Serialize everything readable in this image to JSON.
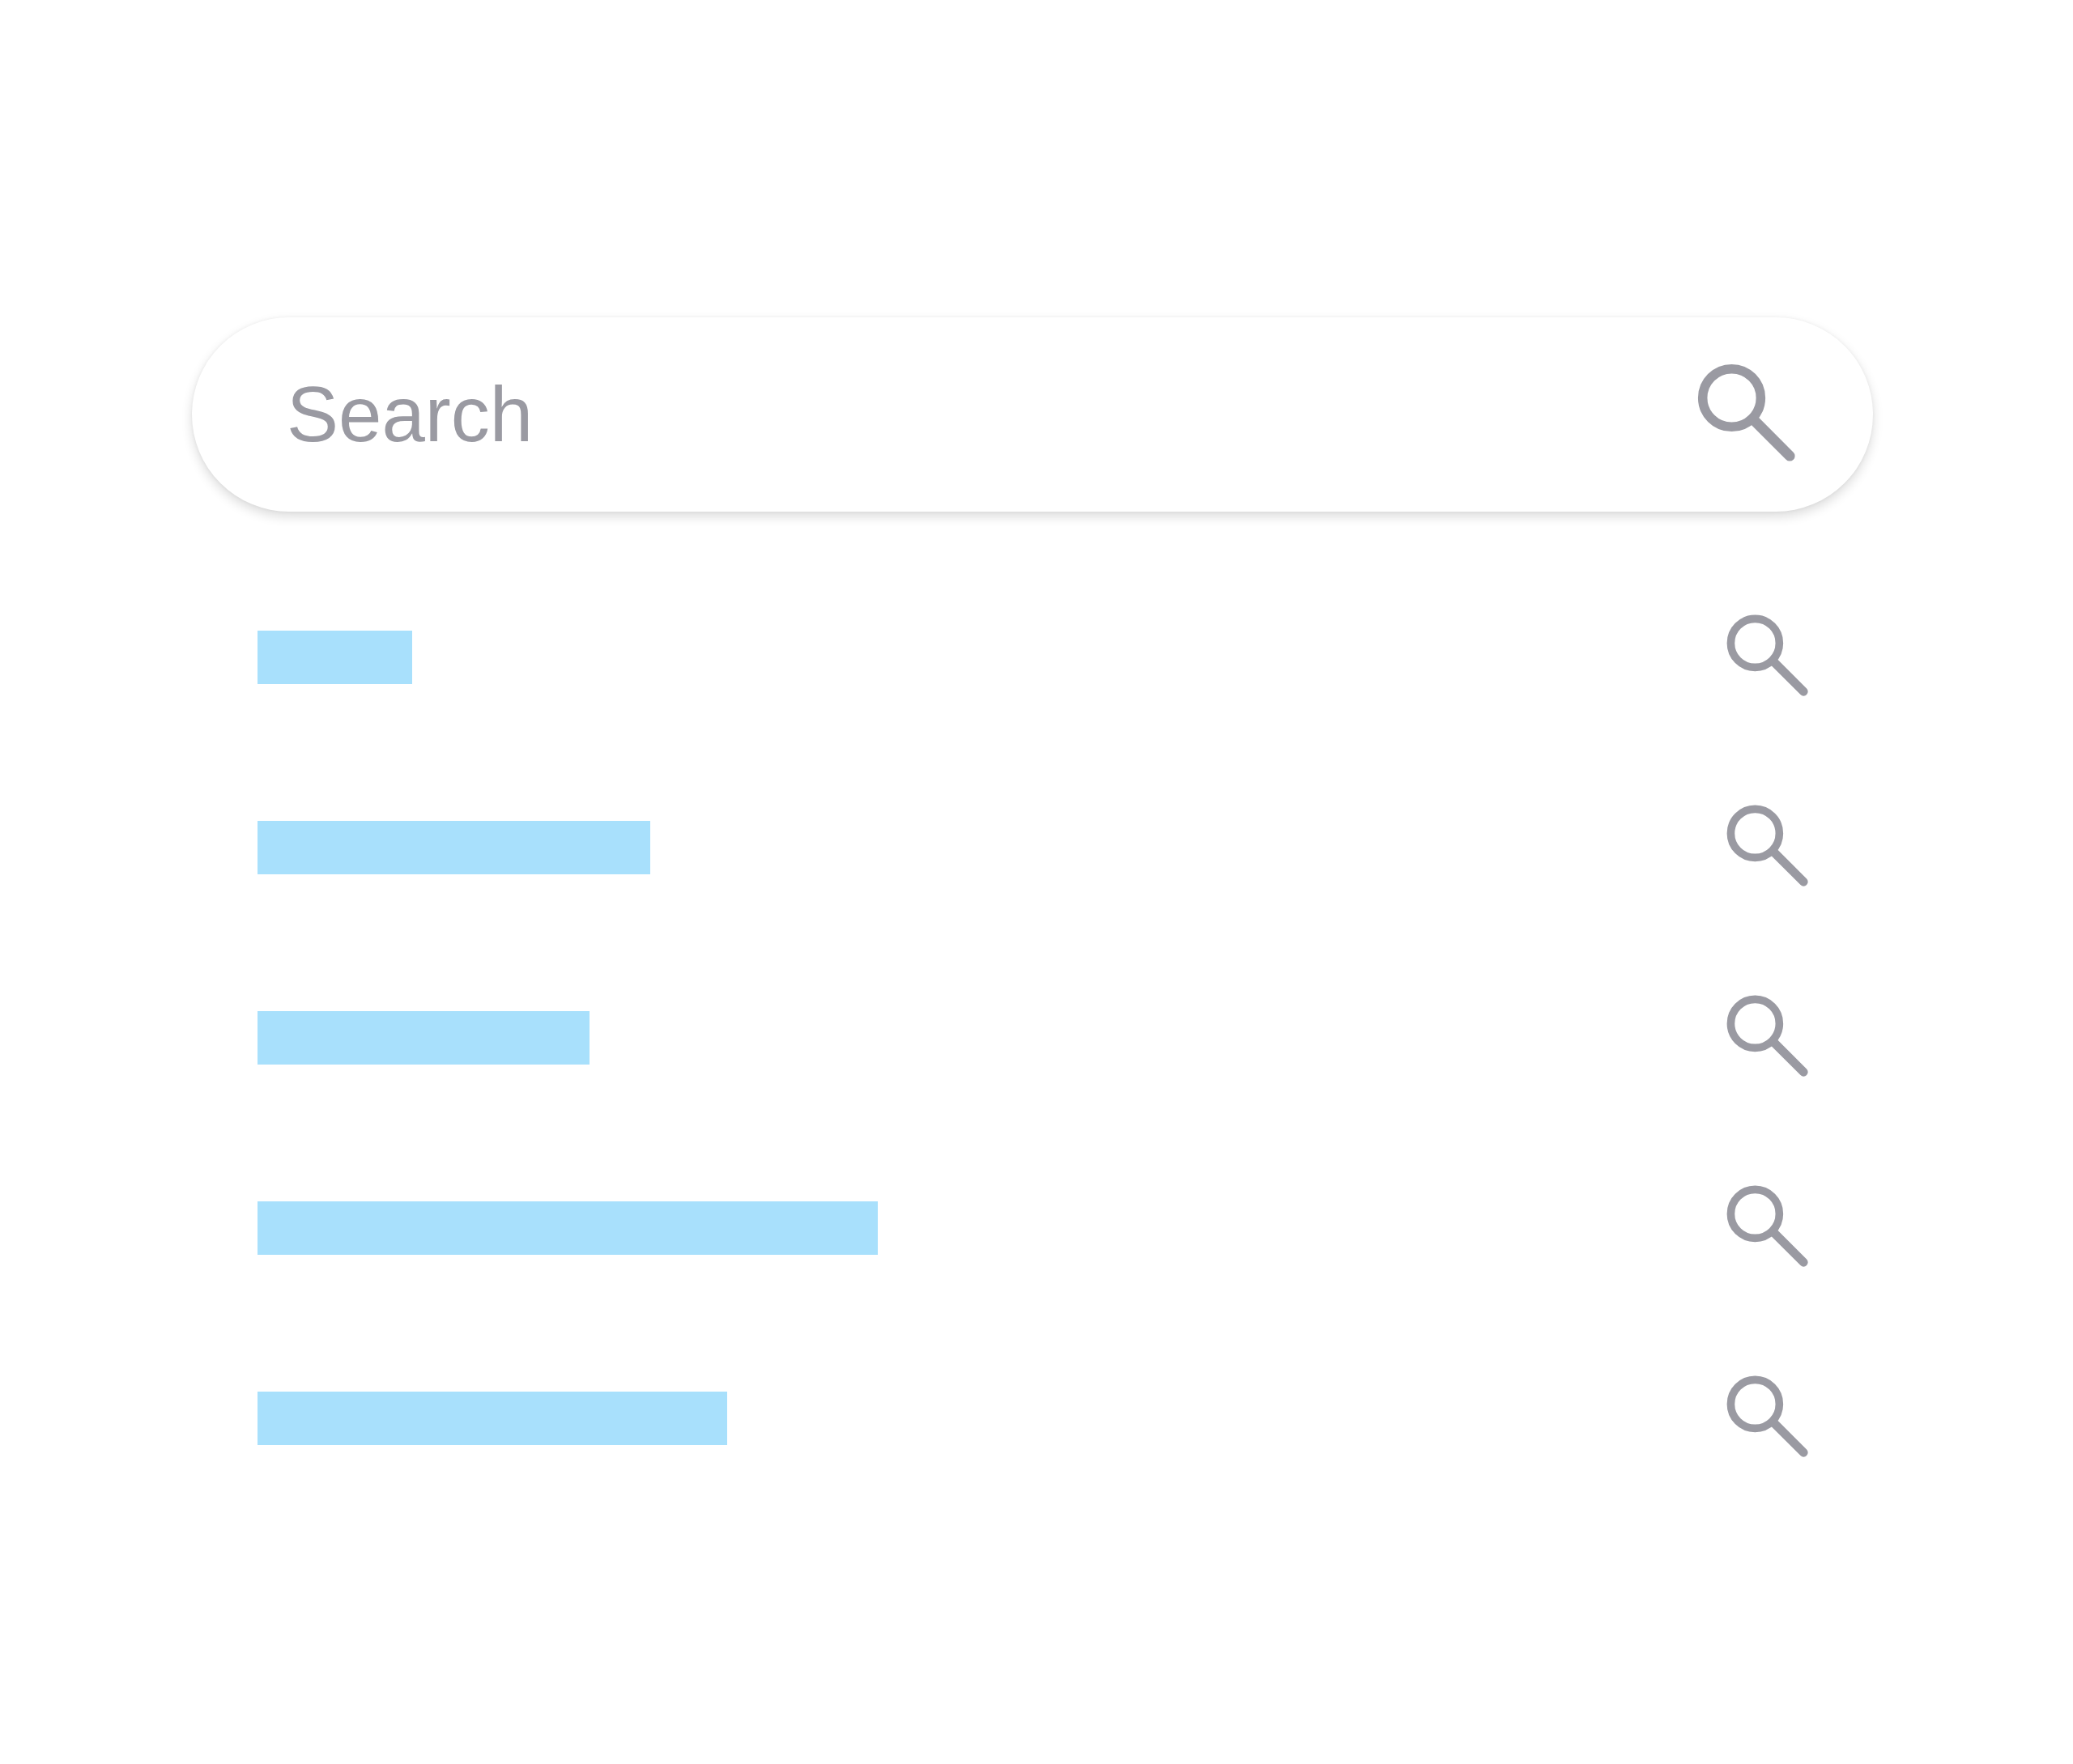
{
  "search": {
    "placeholder": "Search"
  },
  "results": [
    {
      "kind": "skeleton"
    },
    {
      "kind": "skeleton"
    },
    {
      "kind": "skeleton"
    },
    {
      "kind": "skeleton"
    },
    {
      "kind": "skeleton"
    }
  ]
}
